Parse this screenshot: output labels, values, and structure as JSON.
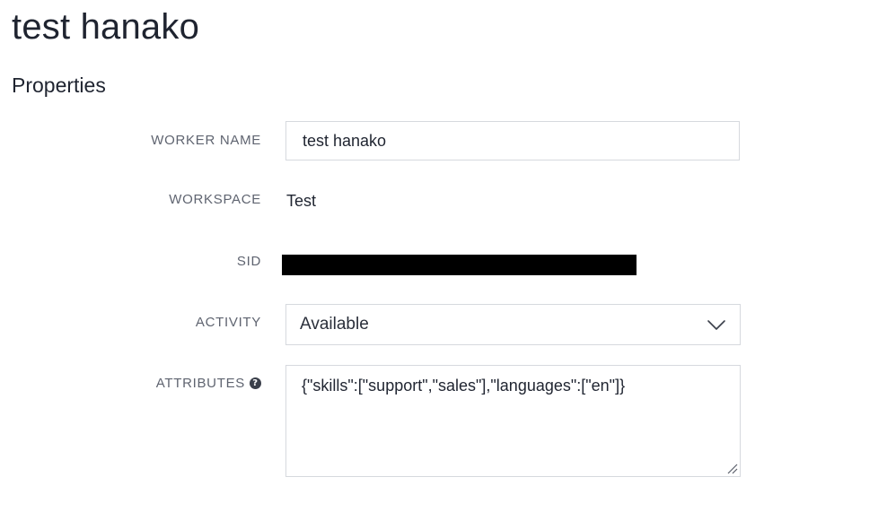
{
  "page": {
    "title": "test hanako",
    "section_title": "Properties"
  },
  "fields": {
    "worker_name": {
      "label": "WORKER NAME",
      "value": "test hanako"
    },
    "workspace": {
      "label": "WORKSPACE",
      "value": "Test"
    },
    "sid": {
      "label": "SID"
    },
    "activity": {
      "label": "ACTIVITY",
      "selected": "Available"
    },
    "attributes": {
      "label": "ATTRIBUTES",
      "help_icon": "question-circle-icon",
      "value": "{\"skills\":[\"support\",\"sales\"],\"languages\":[\"en\"]}"
    }
  },
  "colors": {
    "label": "#5f6470",
    "text": "#1f2430",
    "border": "#d6d9de",
    "redacted": "#000000"
  }
}
